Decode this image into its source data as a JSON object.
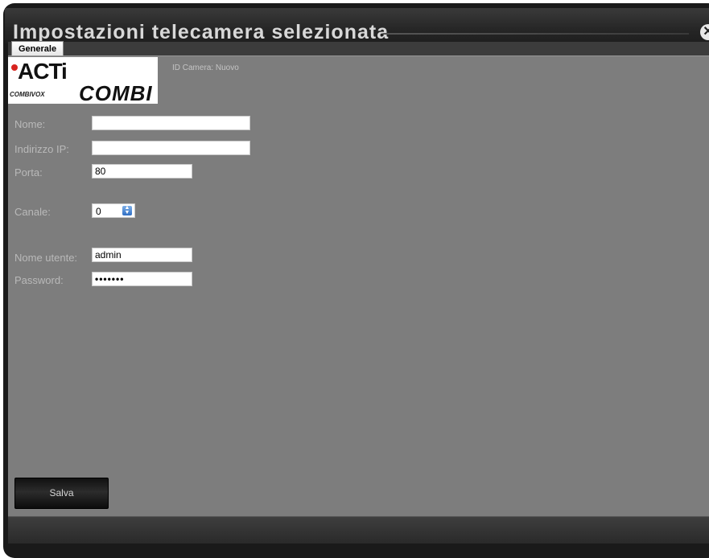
{
  "window": {
    "title": "Impostazioni telecamera selezionata",
    "close_glyph": "✕"
  },
  "tabs": [
    {
      "label": "Generale",
      "active": true
    }
  ],
  "logo": {
    "brand_top": "ACTi",
    "brand_small": "COMBIVOX",
    "brand_bottom": "COMBI"
  },
  "camera_id": "ID Camera:  Nuovo",
  "form": {
    "name": {
      "label": "Nome:",
      "value": ""
    },
    "ip": {
      "label": "Indirizzo IP:",
      "value": ""
    },
    "port": {
      "label": "Porta:",
      "value": "80"
    },
    "channel": {
      "label": "Canale:",
      "value": "0"
    },
    "username": {
      "label": "Nome utente:",
      "value": "admin"
    },
    "password": {
      "label": "Password:",
      "value": "•••••••"
    }
  },
  "save_label": "Salva",
  "colors": {
    "panel": "#7d7d7d",
    "frame": "#1a1a1a",
    "label": "#b9b9b9"
  }
}
